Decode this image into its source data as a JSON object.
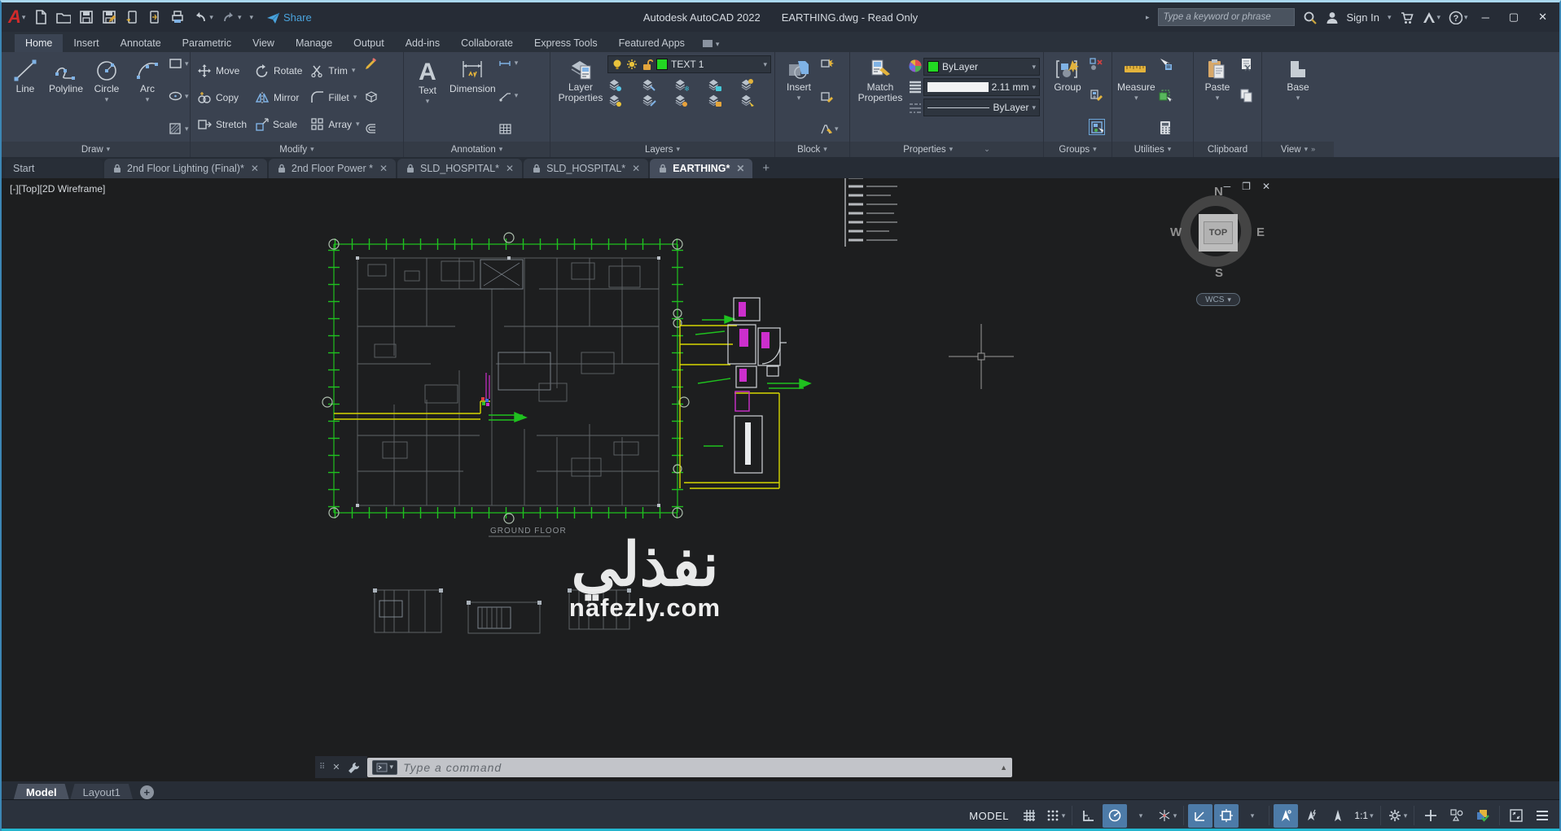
{
  "titlebar": {
    "app_title": "Autodesk AutoCAD 2022",
    "doc_title": "EARTHING.dwg - Read Only",
    "search_placeholder": "Type a keyword or phrase",
    "sign_in_label": "Sign In",
    "share_label": "Share"
  },
  "ribbon_tabs": [
    "Home",
    "Insert",
    "Annotate",
    "Parametric",
    "View",
    "Manage",
    "Output",
    "Add-ins",
    "Collaborate",
    "Express Tools",
    "Featured Apps"
  ],
  "draw_panel": {
    "label": "Draw",
    "line": "Line",
    "polyline": "Polyline",
    "circle": "Circle",
    "arc": "Arc"
  },
  "modify_panel": {
    "label": "Modify",
    "move": "Move",
    "rotate": "Rotate",
    "trim": "Trim",
    "copy": "Copy",
    "mirror": "Mirror",
    "fillet": "Fillet",
    "stretch": "Stretch",
    "scale": "Scale",
    "array": "Array"
  },
  "annotation_panel": {
    "label": "Annotation",
    "text": "Text",
    "dimension": "Dimension"
  },
  "layers_panel": {
    "label": "Layers",
    "layer_properties": "Layer Properties",
    "current_layer": "TEXT 1"
  },
  "block_panel": {
    "label": "Block",
    "insert": "Insert"
  },
  "properties_panel": {
    "label": "Properties",
    "match_properties": "Match Properties",
    "color": "ByLayer",
    "lineweight": "2.11 mm",
    "linetype": "ByLayer"
  },
  "groups_panel": {
    "label": "Groups",
    "group": "Group"
  },
  "utilities_panel": {
    "label": "Utilities",
    "measure": "Measure"
  },
  "clipboard_panel": {
    "label": "Clipboard",
    "paste": "Paste"
  },
  "view_panel": {
    "label": "View",
    "base": "Base"
  },
  "file_tabs": [
    "Start",
    "2nd Floor Lighting (Final)*",
    "2nd Floor Power *",
    "SLD_HOSPITAL*",
    "SLD_HOSPITAL*",
    "EARTHING*"
  ],
  "viewport": {
    "corner_label": "[-][Top][2D Wireframe]",
    "ground_floor_label": "GROUND FLOOR",
    "viewcube": {
      "n": "N",
      "e": "E",
      "s": "S",
      "w": "W",
      "face": "TOP"
    },
    "wcs_label": "WCS"
  },
  "command_line": {
    "placeholder": "Type a command"
  },
  "layout_tabs": {
    "model": "Model",
    "layout1": "Layout1"
  },
  "statusbar": {
    "model_label": "MODEL",
    "scale_label": "1:1"
  },
  "watermark": {
    "name": "نفذلي",
    "site": "nafezly.com"
  },
  "colors": {
    "accent_blue": "#4d7ba8",
    "layer_green": "#22d822",
    "cad_green": "#1fc11f",
    "cad_yellow": "#d6d600",
    "cad_magenta": "#cc2fcc"
  }
}
